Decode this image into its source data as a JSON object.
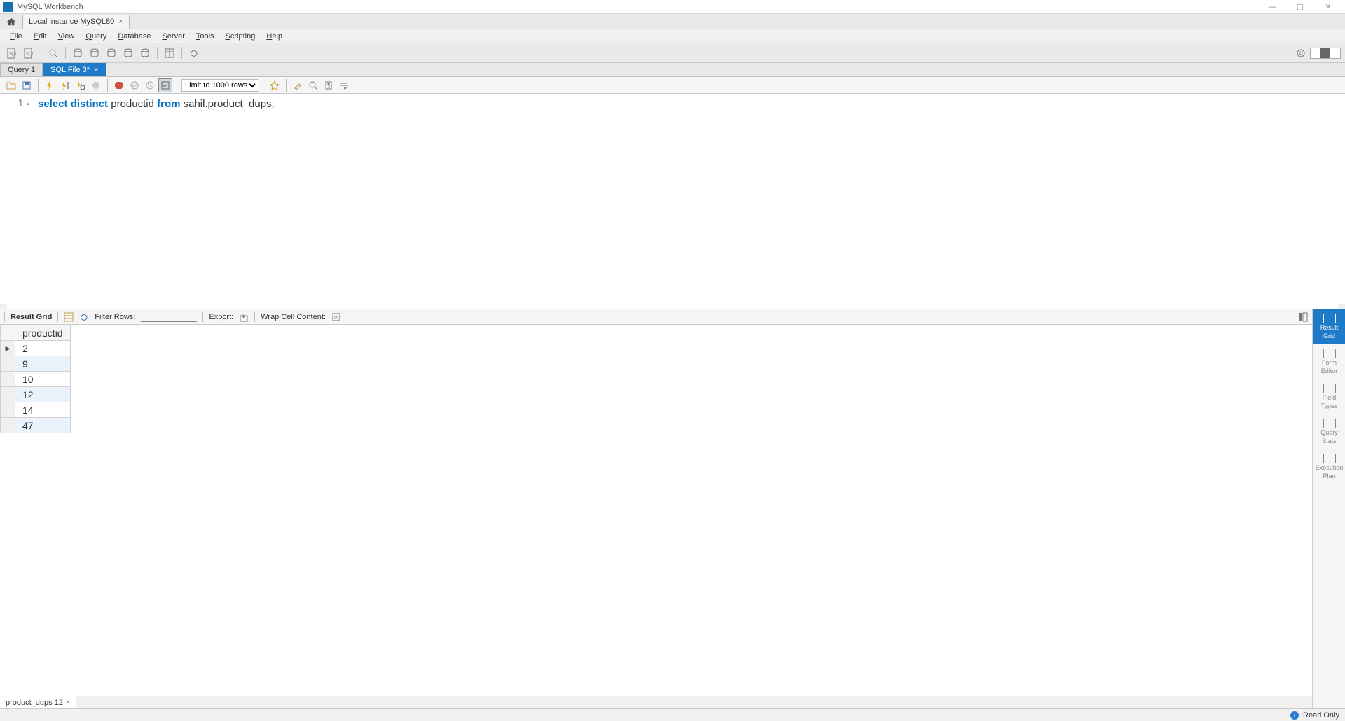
{
  "app": {
    "title": "MySQL Workbench"
  },
  "connection_tab": {
    "label": "Local instance MySQL80"
  },
  "menu": [
    "File",
    "Edit",
    "View",
    "Query",
    "Database",
    "Server",
    "Tools",
    "Scripting",
    "Help"
  ],
  "query_tabs": [
    {
      "label": "Query 1",
      "active": false,
      "closable": false
    },
    {
      "label": "SQL File 3*",
      "active": true,
      "closable": true
    }
  ],
  "sql_toolbar": {
    "row_limit": "Limit to 1000 rows"
  },
  "editor": {
    "line_number": "1",
    "tokens": [
      {
        "t": "select",
        "kw": true
      },
      {
        "t": " ",
        "kw": false
      },
      {
        "t": "distinct",
        "kw": true
      },
      {
        "t": " ",
        "kw": false
      },
      {
        "t": "productid ",
        "kw": false
      },
      {
        "t": "from",
        "kw": true
      },
      {
        "t": " ",
        "kw": false
      },
      {
        "t": "sahil.product_dups;",
        "kw": false
      }
    ]
  },
  "results_toolbar": {
    "result_grid": "Result Grid",
    "filter_label": "Filter Rows:",
    "filter_value": "",
    "export_label": "Export:",
    "wrap_label": "Wrap Cell Content:"
  },
  "grid": {
    "column": "productid",
    "rows": [
      "2",
      "9",
      "10",
      "12",
      "14",
      "47"
    ]
  },
  "result_tab": {
    "label": "product_dups 12"
  },
  "side_tabs": [
    {
      "l1": "Result",
      "l2": "Grid",
      "active": true
    },
    {
      "l1": "Form",
      "l2": "Editor",
      "active": false
    },
    {
      "l1": "Field",
      "l2": "Types",
      "active": false
    },
    {
      "l1": "Query",
      "l2": "Stats",
      "active": false
    },
    {
      "l1": "Execution",
      "l2": "Plan",
      "active": false
    }
  ],
  "status": {
    "text": "Read Only"
  }
}
